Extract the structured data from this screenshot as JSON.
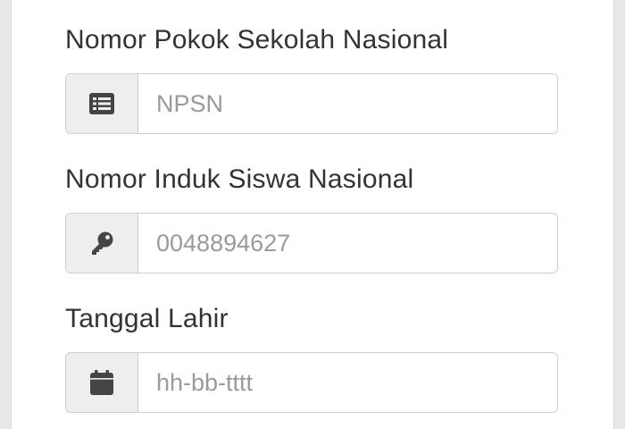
{
  "form": {
    "fields": [
      {
        "label": "Nomor Pokok Sekolah Nasional",
        "placeholder": "NPSN",
        "icon": "list-icon"
      },
      {
        "label": "Nomor Induk Siswa Nasional",
        "placeholder": "0048894627",
        "icon": "key-icon"
      },
      {
        "label": "Tanggal Lahir",
        "placeholder": "hh-bb-tttt",
        "icon": "calendar-icon"
      }
    ]
  },
  "colors": {
    "label_text": "#333333",
    "placeholder_text": "#9a9a9a",
    "addon_background": "#eeeeee",
    "icon_color": "#444444",
    "border": "#cfcfcf"
  }
}
